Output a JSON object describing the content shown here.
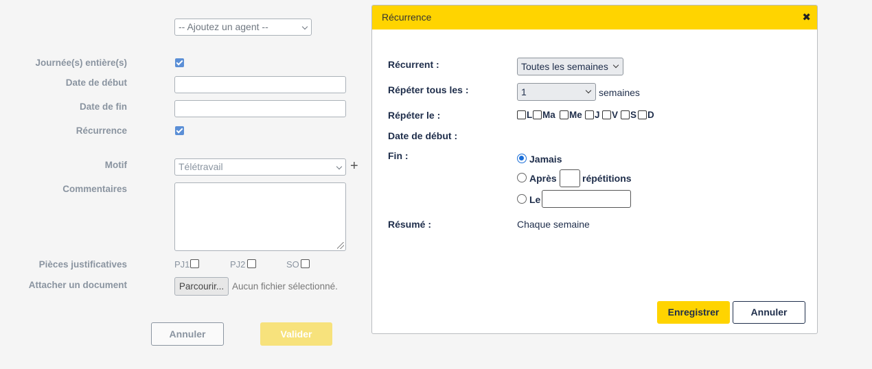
{
  "form": {
    "agent_select": "-- Ajoutez un agent --",
    "labels": {
      "full_day": "Journée(s) entière(s)",
      "start_date": "Date de début",
      "end_date": "Date de fin",
      "recurrence": "Récurrence",
      "motif": "Motif",
      "comments": "Commentaires",
      "attachments": "Pièces justificatives",
      "attach_doc": "Attacher un document"
    },
    "full_day_checked": true,
    "recurrence_checked": true,
    "start_date_value": "",
    "end_date_value": "",
    "motif_value": "Télétravail",
    "comments_value": "",
    "pieces": [
      {
        "label": "PJ1",
        "checked": false
      },
      {
        "label": "PJ2",
        "checked": false
      },
      {
        "label": "SO",
        "checked": false
      }
    ],
    "browse_button": "Parcourir...",
    "no_file": "Aucun fichier sélectionné.",
    "cancel_button": "Annuler",
    "validate_button": "Valider"
  },
  "modal": {
    "title": "Récurrence",
    "close_icon": "close-icon",
    "labels": {
      "recurrent": "Récurrent :",
      "repeat_every": "Répéter tous les :",
      "repeat_on": "Répéter le :",
      "start_date": "Date de début :",
      "end": "Fin :",
      "summary": "Résumé :"
    },
    "recurrent_value": "Toutes les semaines",
    "repeat_every_value": "1",
    "repeat_every_unit": "semaines",
    "days": [
      "L",
      "Ma",
      "Me",
      "J",
      "V",
      "S",
      "D"
    ],
    "end_options": {
      "never": "Jamais",
      "after": "Après",
      "after_suffix": "répétitions",
      "on": "Le",
      "selected": "never"
    },
    "summary_value": "Chaque semaine",
    "save_button": "Enregistrer",
    "cancel_button": "Annuler"
  },
  "colors": {
    "accent": "#ffd400",
    "text_dark": "#1e2d4a",
    "label_gray": "#8a94a0",
    "checkbox_blue": "#5b8fd6"
  }
}
